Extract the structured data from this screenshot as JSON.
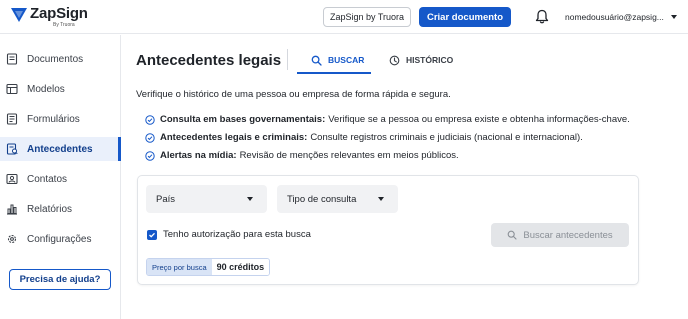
{
  "header": {
    "logo_name": "ZapSign",
    "logo_sub": "By Truora",
    "zapsign_button": "ZapSign by Truora",
    "create_button": "Criar documento",
    "user_email": "nomedousuário@zapsig..."
  },
  "sidebar": {
    "items": [
      {
        "label": "Documentos",
        "icon": "document-icon"
      },
      {
        "label": "Modelos",
        "icon": "template-icon"
      },
      {
        "label": "Formulários",
        "icon": "form-icon"
      },
      {
        "label": "Antecedentes",
        "icon": "background-check-icon",
        "active": true
      },
      {
        "label": "Contatos",
        "icon": "contact-icon"
      },
      {
        "label": "Relatórios",
        "icon": "report-icon"
      },
      {
        "label": "Configurações",
        "icon": "gear-icon"
      }
    ],
    "help_button": "Precisa de ajuda?"
  },
  "main": {
    "title": "Antecedentes legais",
    "tabs": [
      {
        "label": "BUSCAR",
        "icon": "search-icon",
        "active": true
      },
      {
        "label": "HISTÓRICO",
        "icon": "history-icon",
        "active": false
      }
    ],
    "intro": "Verifique o histórico de uma pessoa ou empresa de forma rápida e segura.",
    "bullets": [
      {
        "bold": "Consulta em bases governamentais:",
        "text": "Verifique se a pessoa ou empresa existe e obtenha informações-chave."
      },
      {
        "bold": "Antecedentes legais e criminais:",
        "text": "Consulte registros criminais e judiciais (nacional e internacional)."
      },
      {
        "bold": "Alertas na mídia:",
        "text": "Revisão de menções relevantes em meios públicos."
      }
    ],
    "form": {
      "country_select": "País",
      "query_type_select": "Tipo de consulta",
      "authorization_label": "Tenho autorização para esta busca",
      "authorization_checked": true,
      "search_button": "Buscar antecedentes",
      "price_label": "Preço por busca",
      "price_value": "90 créditos"
    }
  },
  "colors": {
    "primary": "#1558c9",
    "active_bg": "#eaf0fb",
    "check": "#1558c9"
  }
}
